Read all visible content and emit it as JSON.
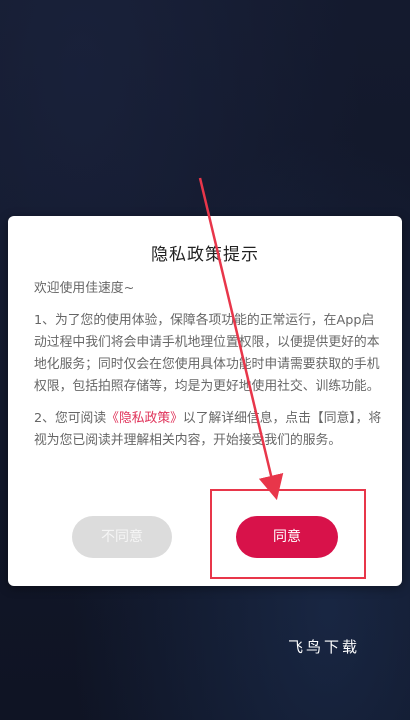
{
  "dialog": {
    "title": "隐私政策提示",
    "greeting": "欢迎使用佳速度~",
    "paragraph1": "1、为了您的使用体验，保障各项功能的正常运行，在App启动过程中我们将会申请手机地理位置权限，以便提供更好的本地化服务；同时仅会在您使用具体功能时申请需要获取的手机权限，包括拍照存储等，均是为更好地使用社交、训练功能。",
    "paragraph2_prefix": "2、您可阅读",
    "paragraph2_link": "《隐私政策》",
    "paragraph2_suffix": "以了解详细信息，点击【同意】，将视为您已阅读并理解相关内容，开始接受我们的服务。",
    "disagree_label": "不同意",
    "agree_label": "同意"
  },
  "annotation": {
    "color": "#e8364a"
  },
  "watermark": {
    "text": "飞鸟下载"
  }
}
